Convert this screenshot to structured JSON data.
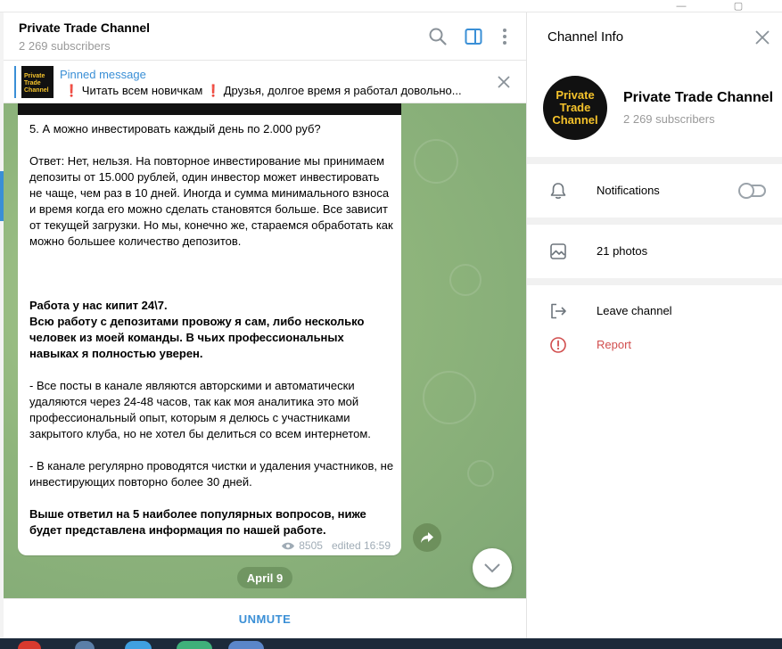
{
  "chat": {
    "title": "Private Trade Channel",
    "subscribers": "2 269 subscribers"
  },
  "pinned": {
    "title": "Pinned message",
    "preview": "❗ Читать всем новичкам ❗  Друзья, долгое время я работал довольно..."
  },
  "logo": {
    "line1": "Private",
    "line2": "Trade",
    "line3": "Channel"
  },
  "message": {
    "paragraphs": [
      {
        "text": "5. А можно инвестировать каждый день по 2.000 руб?",
        "bold": false
      },
      {
        "text": "Ответ: Нет, нельзя. На повторное инвестирование мы принимаем депозиты от 15.000 рублей, один инвестор может инвестировать не чаще, чем раз в 10 дней. Иногда и сумма минимального взноса и время когда его можно сделать становятся больше. Все зависит от текущей загрузки. Но мы, конечно же, стараемся обработать как можно большее количество депозитов.",
        "bold": false
      },
      {
        "text": "Работа у нас кипит 24\\7.",
        "bold": true
      },
      {
        "text": "Всю работу с депозитами провожу я сам, либо несколько человек из моей команды.  В чьих профессиональных навыках я полностью уверен.",
        "bold": true
      },
      {
        "text": "- Все посты в канале являются авторскими и автоматически удаляются через 24-48 часов, так как моя аналитика это мой профессиональный опыт, которым я делюсь с участниками закрытого клуба, но не хотел бы делиться со всем интернетом.",
        "bold": false
      },
      {
        "text": "- В канале регулярно проводятся чистки и удаления участников, не инвестирующих  повторно более 30 дней.",
        "bold": false
      },
      {
        "text": "Выше ответил на 5 наиболее популярных вопросов, ниже будет представлена информация по нашей работе.",
        "bold": true
      }
    ],
    "views": "8505",
    "edited": "edited 16:59"
  },
  "date_pill": "April 9",
  "unmute_label": "UNMUTE",
  "info": {
    "title": "Channel Info",
    "name": "Private Trade Channel",
    "subscribers": "2 269 subscribers",
    "notifications_label": "Notifications",
    "notifications_enabled": false,
    "photos_label": "21 photos",
    "leave_label": "Leave channel",
    "report_label": "Report"
  },
  "colors": {
    "accent": "#3a8fd6",
    "danger": "#d14e4e",
    "logo_gold": "#f4c22b"
  }
}
